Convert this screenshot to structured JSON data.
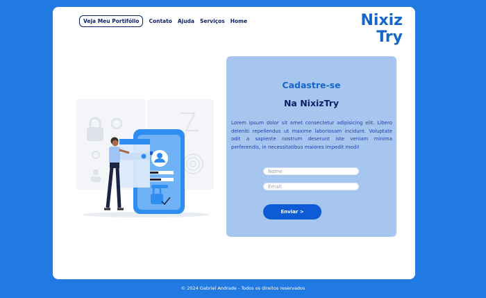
{
  "nav": {
    "portfolio": "Veja Meu Portifólio",
    "links": [
      "Contato",
      "Ajuda",
      "Serviços",
      "Home"
    ]
  },
  "logo": {
    "line1": "Nixiz",
    "line2": "Try"
  },
  "signup": {
    "title": "Cadastre-se",
    "subtitle": "Na NixizTry",
    "description": "Lorem ipsum dolor sit amet consectetur adipisicing elit. Libero deleniti repellendus ut maxime laboriosam incidunt. Voluptate odit a sapiente nostrum deserunt iste veniam minima perferendis, in necessitatibus maiores impedit modi!",
    "name_placeholder": "Nome",
    "email_placeholder": "Email",
    "submit_label": "Enviar >"
  },
  "footer": {
    "text": "© 2024 Gabriel Andrade - Todos os direitos reservados"
  },
  "colors": {
    "background": "#2179e2",
    "accent": "#1566c8",
    "panel": "#a6c6f0",
    "button": "#0d5cd6"
  }
}
